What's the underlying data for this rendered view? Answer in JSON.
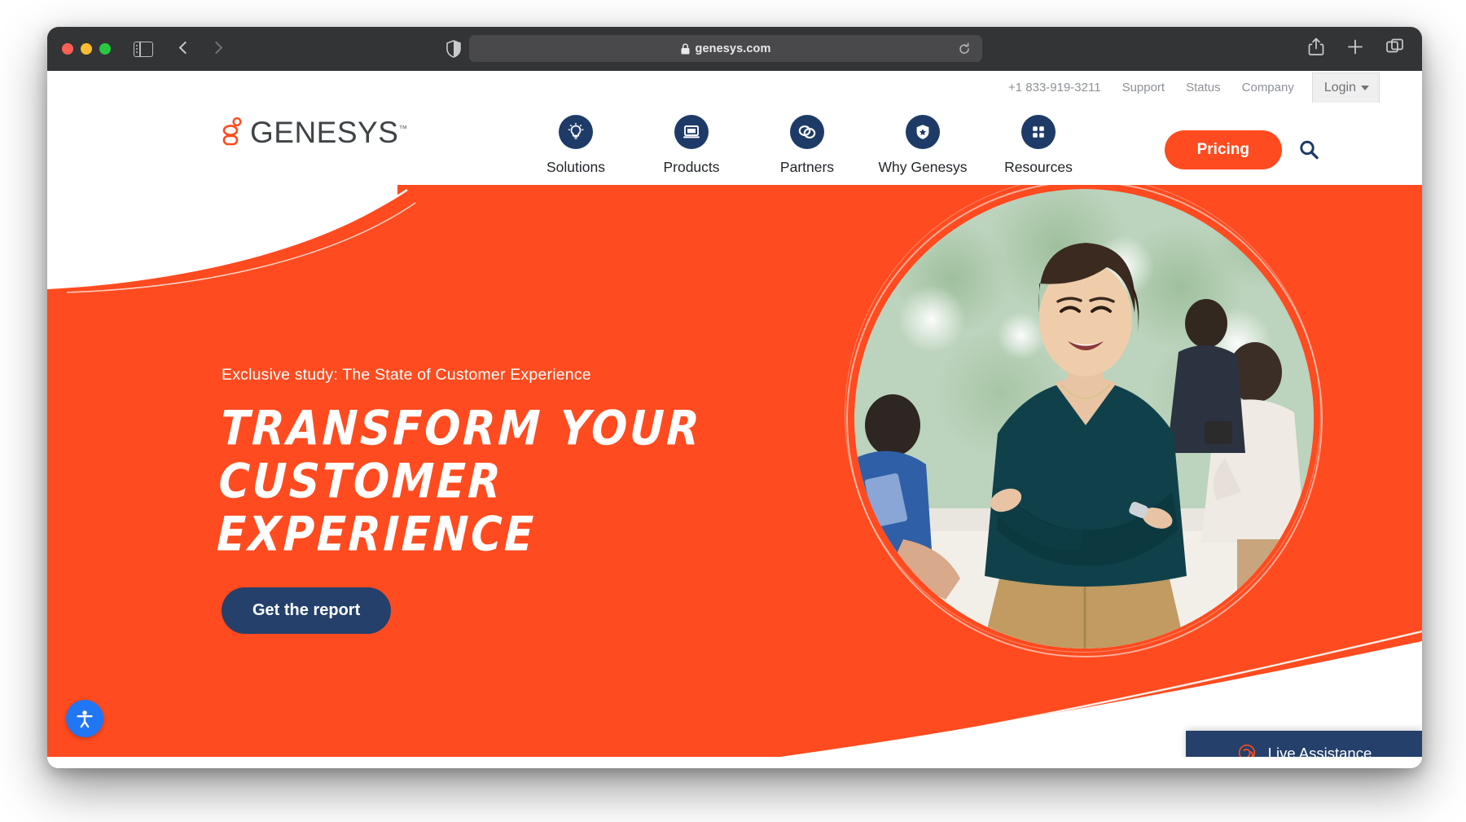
{
  "browser": {
    "name": "safari",
    "traffic_lights": [
      "close",
      "minimize",
      "zoom"
    ],
    "sidebar_icon": "sidebar-icon",
    "back_icon": "chevron-left-icon",
    "forward_icon": "chevron-right-icon",
    "shield_icon": "shield-icon",
    "lock_icon": "lock-icon",
    "url": "genesys.com",
    "reload_icon": "reload-icon",
    "share_icon": "share-icon",
    "newtab_icon": "plus-icon",
    "tabs_icon": "tab-overview-icon"
  },
  "utility": {
    "phone": "+1 833-919-3211",
    "links": [
      "Support",
      "Status",
      "Company"
    ],
    "login_label": "Login",
    "login_caret_icon": "chevron-down-icon"
  },
  "brand": {
    "logo_text": "GENESYS",
    "logo_tm": "™",
    "logo_mark_icon": "genesys-mark-icon",
    "accent_orange": "#ff4b1f",
    "navy": "#1e3b68"
  },
  "nav": {
    "items": [
      {
        "label": "Solutions",
        "icon": "lightbulb-icon"
      },
      {
        "label": "Products",
        "icon": "laptop-icon"
      },
      {
        "label": "Partners",
        "icon": "linked-rings-icon"
      },
      {
        "label": "Why Genesys",
        "icon": "shield-star-icon"
      },
      {
        "label": "Resources",
        "icon": "grid-dots-icon"
      }
    ],
    "pricing_label": "Pricing",
    "search_icon": "search-icon"
  },
  "hero": {
    "eyebrow": "Exclusive study: The State of Customer Experience",
    "headline_line1": "Transform Your",
    "headline_line2": "Customer Experience",
    "cta_label": "Get the report",
    "photo_alt": "Smiling businesswoman with arms crossed in front of blurred office colleagues",
    "background_color": "#ff4b1f"
  },
  "widgets": {
    "accessibility_icon": "accessibility-person-icon",
    "live_assistance_label": "Live Assistance",
    "live_assistance_icon": "headset-icon"
  }
}
